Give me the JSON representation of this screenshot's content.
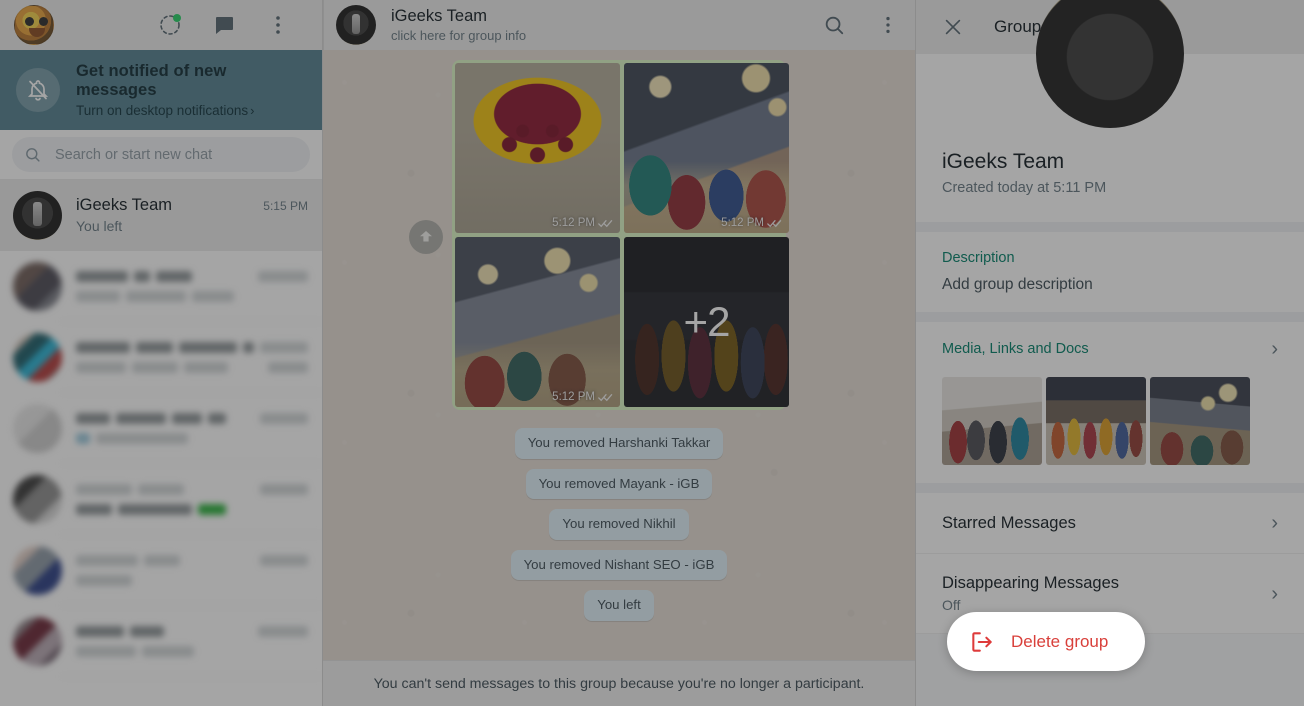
{
  "left_pane": {
    "header": {
      "avatar_name": "my-profile-avatar",
      "status_icon": "status-ring-icon",
      "new_chat_icon": "new-chat-icon",
      "menu_icon": "overflow-menu-icon"
    },
    "notification_banner": {
      "icon": "bell-off-icon",
      "title": "Get notified of new messages",
      "subtitle": "Turn on desktop notifications",
      "chevron": "›",
      "bg_color": "#53808f"
    },
    "search": {
      "icon": "search-icon",
      "placeholder": "Search or start new chat",
      "value": ""
    },
    "chats": [
      {
        "name": "iGeeks Team",
        "time": "5:15 PM",
        "message": "You left",
        "active": true
      }
    ],
    "blurred_row_count": 6
  },
  "chat_pane": {
    "header": {
      "title": "iGeeks Team",
      "subtitle": "click here for group info",
      "search_icon": "search-icon",
      "menu_icon": "overflow-menu-icon"
    },
    "album": {
      "forward_icon": "forward-arrow-icon",
      "photos": [
        {
          "caption": "",
          "time": "5:12 PM",
          "status": "read"
        },
        {
          "caption": "",
          "time": "5:12 PM",
          "status": "read"
        },
        {
          "caption": "",
          "time": "5:12 PM",
          "status": "read"
        },
        {
          "caption": "",
          "time": "",
          "status": "",
          "overlay": "+2"
        }
      ]
    },
    "system_messages": [
      "You removed Harshanki Takkar",
      "You removed Mayank - iGB",
      "You removed Nikhil",
      "You removed Nishant SEO - iGB",
      "You left"
    ],
    "footer_notice": "You can't send messages to this group because you're no longer a participant."
  },
  "info_pane": {
    "close_icon": "close-icon",
    "title": "Group info",
    "group_name": "iGeeks Team",
    "created": "Created today at 5:11 PM",
    "description": {
      "label": "Description",
      "value": "Add group description"
    },
    "media": {
      "label": "Media, Links and Docs",
      "chevron": "›",
      "thumb_count": 3
    },
    "starred": {
      "label": "Starred Messages",
      "chevron": "›"
    },
    "disappearing": {
      "label": "Disappearing Messages",
      "value": "Off",
      "chevron": "›"
    },
    "delete_group": {
      "icon": "exit-group-icon",
      "label": "Delete group",
      "color": "#d9403b"
    },
    "accent_color": "#008069"
  }
}
